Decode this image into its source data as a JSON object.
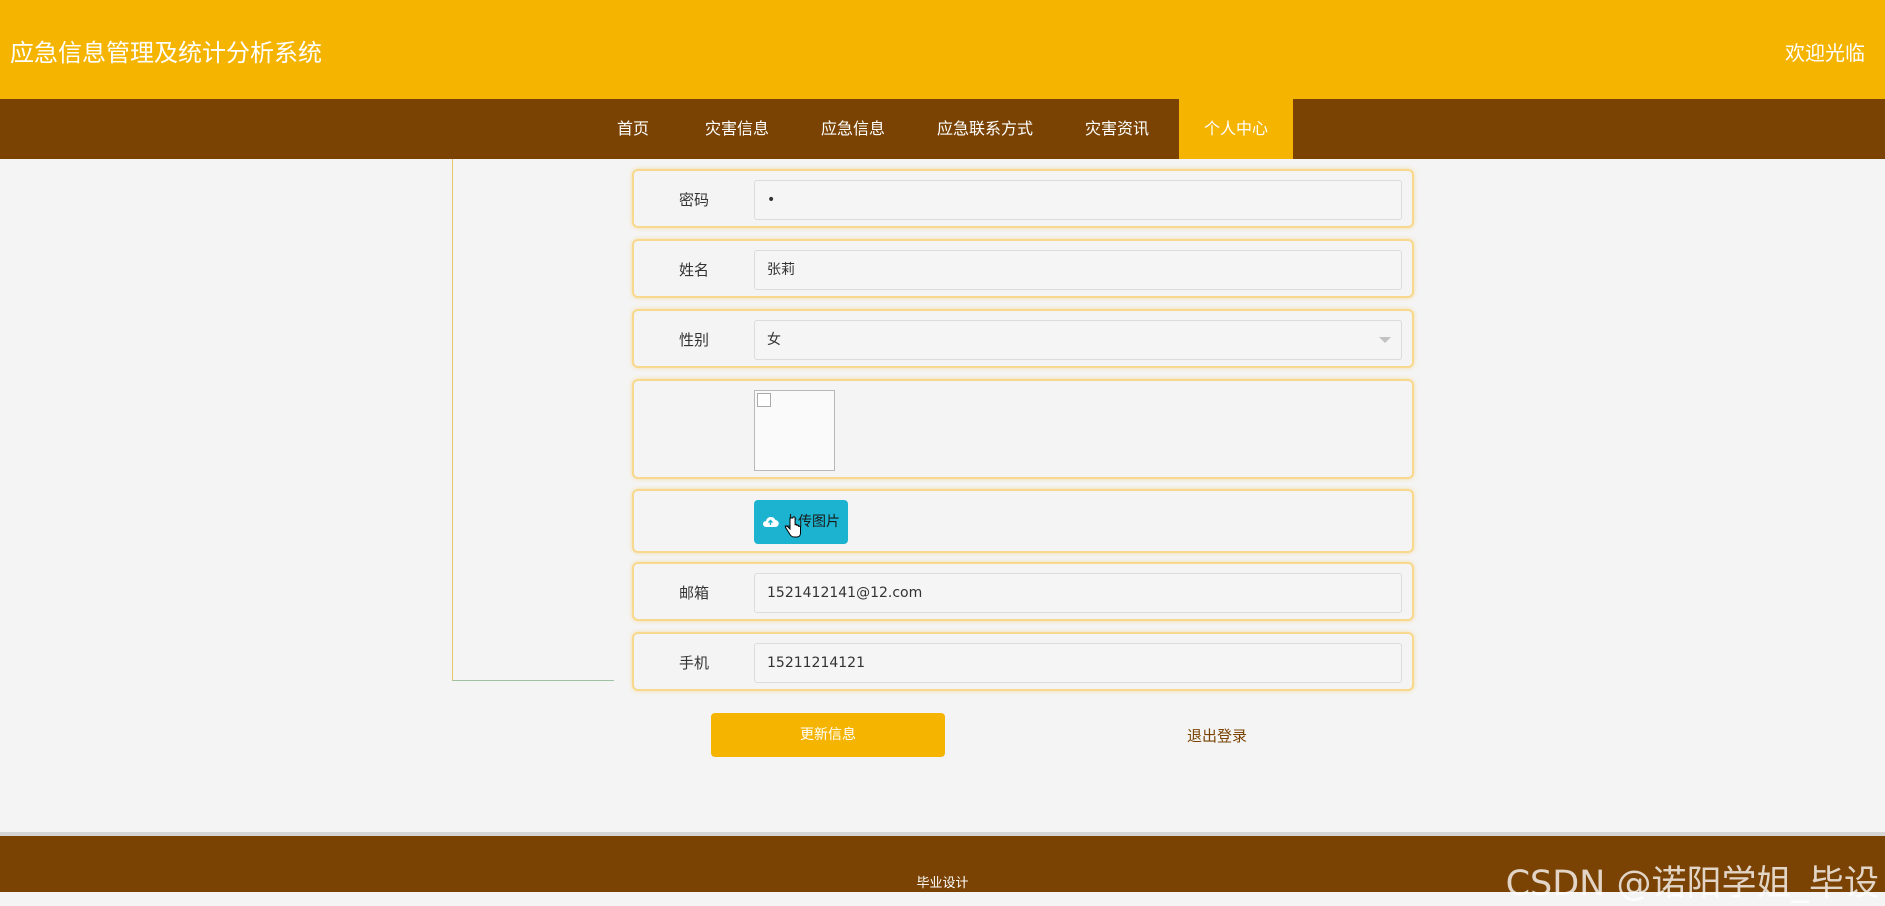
{
  "header": {
    "title": "应急信息管理及统计分析系统",
    "welcome": "欢迎光临"
  },
  "nav": {
    "items": [
      {
        "label": "首页"
      },
      {
        "label": "灾害信息"
      },
      {
        "label": "应急信息"
      },
      {
        "label": "应急联系方式"
      },
      {
        "label": "灾害资讯"
      },
      {
        "label": "个人中心"
      }
    ],
    "active": "个人中心"
  },
  "form": {
    "password": {
      "label": "密码",
      "value": "•"
    },
    "name": {
      "label": "姓名",
      "value": "张莉"
    },
    "gender": {
      "label": "性别",
      "value": "女"
    },
    "upload": {
      "label": "上传图片"
    },
    "email": {
      "label": "邮箱",
      "value": "1521412141@12.com"
    },
    "phone": {
      "label": "手机",
      "value": "15211214121"
    }
  },
  "actions": {
    "update": "更新信息",
    "logout": "退出登录"
  },
  "footer": {
    "text": "毕业设计",
    "watermark": "CSDN @诺阳学姐_毕设"
  },
  "colors": {
    "primary": "#f5b400",
    "nav": "#7a4303",
    "upload": "#1bb3cf"
  }
}
